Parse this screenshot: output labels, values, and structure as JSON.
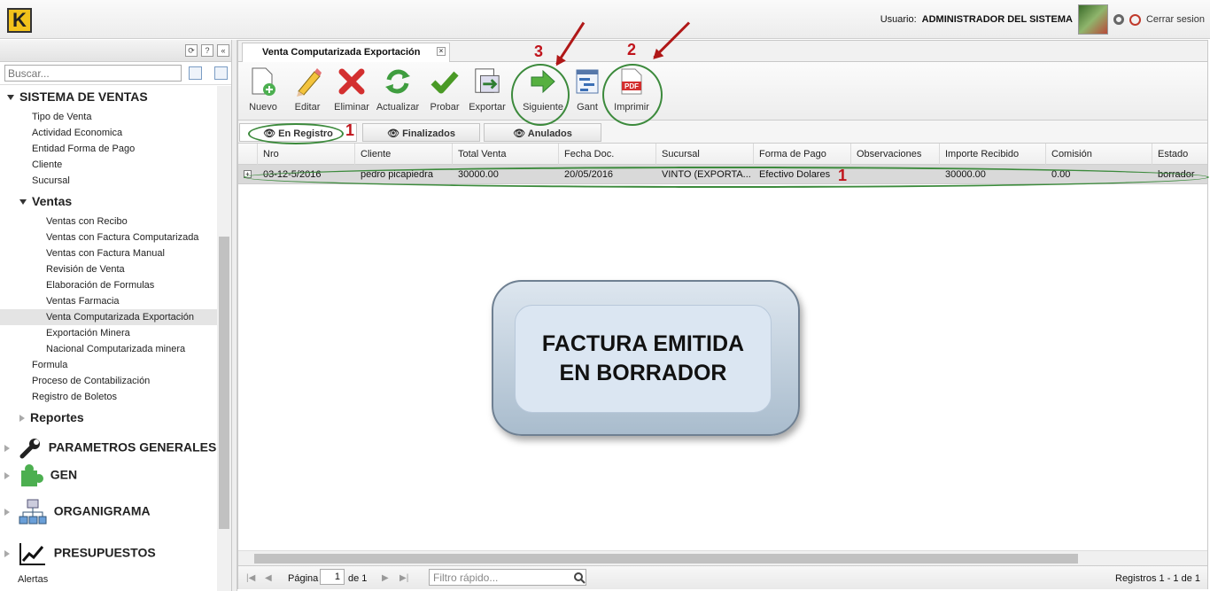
{
  "header": {
    "user_label": "Usuario:",
    "user_name": "ADMINISTRADOR DEL SISTEMA",
    "logout_label": "Cerrar sesion"
  },
  "sidebar": {
    "search_placeholder": "Buscar...",
    "tree": [
      {
        "label": "SISTEMA DE VENTAS",
        "level": "h1",
        "expanded": true
      },
      {
        "label": "Tipo de Venta",
        "level": "item"
      },
      {
        "label": "Actividad Economica",
        "level": "item"
      },
      {
        "label": "Entidad Forma de Pago",
        "level": "item"
      },
      {
        "label": "Cliente",
        "level": "item"
      },
      {
        "label": "Sucursal",
        "level": "item"
      },
      {
        "label": "Ventas",
        "level": "h2",
        "expanded": true
      },
      {
        "label": "Ventas con Recibo",
        "level": "subitem"
      },
      {
        "label": "Ventas con Factura Computarizada",
        "level": "subitem"
      },
      {
        "label": "Ventas con Factura Manual",
        "level": "subitem"
      },
      {
        "label": "Revisión de Venta",
        "level": "subitem"
      },
      {
        "label": "Elaboración de Formulas",
        "level": "subitem"
      },
      {
        "label": "Ventas Farmacia",
        "level": "subitem"
      },
      {
        "label": "Venta Computarizada Exportación",
        "level": "subitem",
        "selected": true
      },
      {
        "label": "Exportación Minera",
        "level": "subitem"
      },
      {
        "label": "Nacional Computarizada minera",
        "level": "subitem"
      },
      {
        "label": "Formula",
        "level": "item"
      },
      {
        "label": "Proceso de Contabilización",
        "level": "item"
      },
      {
        "label": "Registro de Boletos",
        "level": "item"
      },
      {
        "label": "Reportes",
        "level": "h2",
        "expanded": false
      },
      {
        "label": "PARAMETROS GENERALES",
        "level": "h1",
        "expanded": false,
        "icon": "wrench-icon"
      },
      {
        "label": "GEN",
        "level": "h1",
        "expanded": false,
        "icon": "puzzle-icon"
      },
      {
        "label": "ORGANIGRAMA",
        "level": "h1",
        "expanded": false,
        "icon": "org-chart-icon"
      },
      {
        "label": "PRESUPUESTOS",
        "level": "h1",
        "expanded": false,
        "icon": "trend-chart-icon"
      },
      {
        "label": "Alertas",
        "level": "item"
      }
    ]
  },
  "main": {
    "tab_title": "Venta Computarizada Exportación",
    "toolbar": [
      {
        "label": "Nuevo",
        "icon": "new-document-icon"
      },
      {
        "label": "Editar",
        "icon": "pencil-icon"
      },
      {
        "label": "Eliminar",
        "icon": "delete-x-icon"
      },
      {
        "label": "Actualizar",
        "icon": "refresh-icon"
      },
      {
        "label": "Probar",
        "icon": "checkmark-icon"
      },
      {
        "label": "Exportar",
        "icon": "export-icon"
      },
      {
        "label": "Siguiente",
        "icon": "next-arrow-icon"
      },
      {
        "label": "Gant",
        "icon": "gantt-icon"
      },
      {
        "label": "Imprimir",
        "icon": "pdf-icon",
        "icon_text": "PDF"
      }
    ],
    "subtabs": [
      {
        "label": "En Registro",
        "active": true
      },
      {
        "label": "Finalizados",
        "active": false
      },
      {
        "label": "Anulados",
        "active": false
      }
    ],
    "columns": [
      "Nro",
      "Cliente",
      "Total Venta",
      "Fecha Doc.",
      "Sucursal",
      "Forma de Pago",
      "Observaciones",
      "Importe Recibido",
      "Comisión",
      "Estado"
    ],
    "rows": [
      {
        "nro": "03-12-5/2016",
        "cliente": "pedro picapiedra",
        "total_venta": "30000.00",
        "fecha_doc": "20/05/2016",
        "sucursal": "VINTO (EXPORTA...",
        "forma_pago": "Efectivo Dolares",
        "observaciones": "",
        "importe_recibido": "30000.00",
        "comision": "0.00",
        "estado": "borrador"
      }
    ],
    "pager": {
      "page_label": "Página",
      "page_value": "1",
      "of_label": "de 1",
      "filter_placeholder": "Filtro rápido...",
      "records": "Registros 1 - 1 de 1"
    }
  },
  "annotations": {
    "markers": [
      "1",
      "1",
      "2",
      "3"
    ],
    "callout_line1": "FACTURA EMITIDA",
    "callout_line2": "EN BORRADOR",
    "annotation_color": "#c0141c",
    "highlight_color": "#3c8a3c"
  }
}
